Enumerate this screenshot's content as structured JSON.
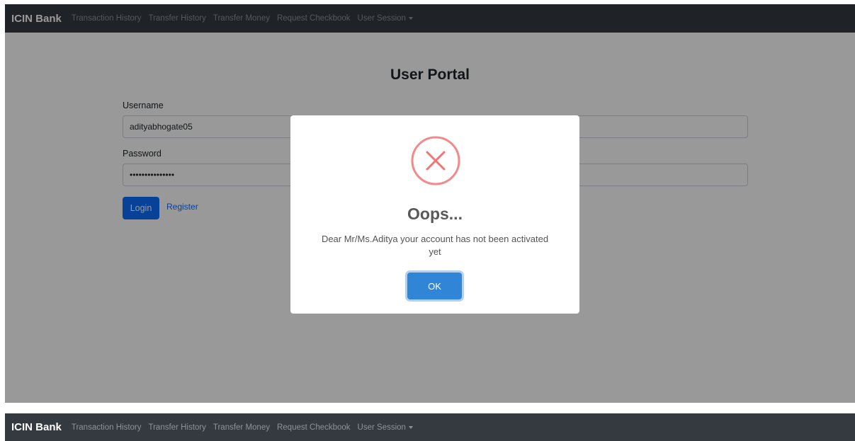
{
  "navbar": {
    "brand": "ICIN Bank",
    "items": [
      {
        "label": "Transaction History"
      },
      {
        "label": "Transfer History"
      },
      {
        "label": "Transfer Money"
      },
      {
        "label": "Request Checkbook"
      },
      {
        "label": "User Session"
      }
    ]
  },
  "portal": {
    "title": "User Portal",
    "username_label": "Username",
    "username_value": "adityabhogate05",
    "password_label": "Password",
    "password_value": "•••••••••••••••",
    "login_label": "Login",
    "register_label": "Register"
  },
  "modal": {
    "icon": "error-x-icon",
    "title": "Oops...",
    "message": "Dear Mr/Ms.Aditya your account has not been activated yet",
    "ok_label": "OK"
  },
  "colors": {
    "navbar_bg": "#343a40",
    "primary": "#0d6efd",
    "ok_button": "#3085d6",
    "error_icon": "#f27474"
  }
}
